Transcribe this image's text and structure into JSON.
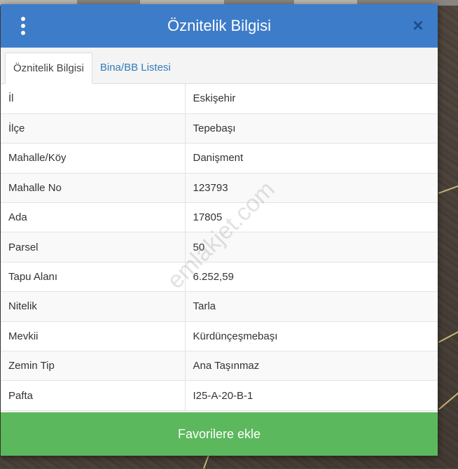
{
  "dialog": {
    "title": "Öznitelik Bilgisi",
    "close_symbol": "×",
    "menu_icon": "vertical-dots-icon",
    "header_color": "#3d7cc9"
  },
  "tabs": [
    {
      "label": "Öznitelik Bilgisi",
      "active": true
    },
    {
      "label": "Bina/BB Listesi",
      "active": false
    }
  ],
  "attributes": [
    {
      "key": "İl",
      "value": "Eskişehir"
    },
    {
      "key": "İlçe",
      "value": "Tepebaşı"
    },
    {
      "key": "Mahalle/Köy",
      "value": "Danişment"
    },
    {
      "key": "Mahalle No",
      "value": "123793"
    },
    {
      "key": "Ada",
      "value": "17805"
    },
    {
      "key": "Parsel",
      "value": "50"
    },
    {
      "key": "Tapu Alanı",
      "value": "6.252,59"
    },
    {
      "key": "Nitelik",
      "value": "Tarla"
    },
    {
      "key": "Mevkii",
      "value": "Kürdünçeşmebaşı"
    },
    {
      "key": "Zemin Tip",
      "value": "Ana Taşınmaz"
    },
    {
      "key": "Pafta",
      "value": "I25-A-20-B-1"
    }
  ],
  "favorite_button": {
    "label": "Favorilere ekle",
    "color": "#5cb85c"
  },
  "watermark": "emlakjet.com"
}
